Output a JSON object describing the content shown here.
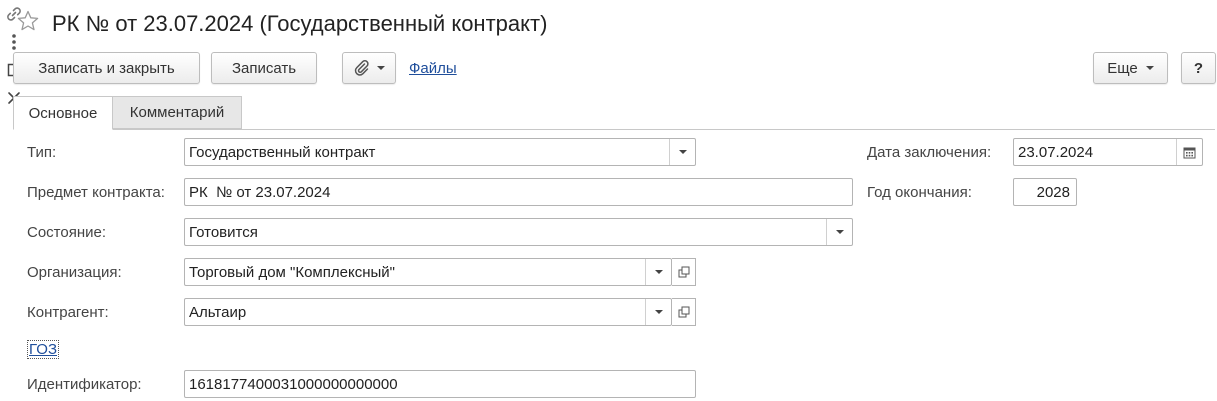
{
  "window": {
    "title": "РК  № от 23.07.2024 (Государственный контракт)"
  },
  "toolbar": {
    "save_close_label": "Записать и закрыть",
    "save_label": "Записать",
    "files_link": "Файлы",
    "more_label": "Еще",
    "help_label": "?"
  },
  "tabs": [
    {
      "label": "Основное",
      "active": true
    },
    {
      "label": "Комментарий",
      "active": false
    }
  ],
  "form": {
    "type": {
      "label": "Тип:",
      "value": "Государственный контракт"
    },
    "subject": {
      "label": "Предмет контракта:",
      "value": "РК  № от 23.07.2024"
    },
    "state": {
      "label": "Состояние:",
      "value": "Готовится"
    },
    "organization": {
      "label": "Организация:",
      "value": "Торговый дом \"Комплексный\""
    },
    "counterparty": {
      "label": "Контрагент:",
      "value": "Альтаир"
    },
    "goz_link": "ГОЗ",
    "identifier": {
      "label": "Идентификатор:",
      "value": "1618177400031000000000000"
    },
    "conclusion_date": {
      "label": "Дата заключения:",
      "value": "23.07.2024"
    },
    "end_year": {
      "label": "Год окончания:",
      "value": "2028"
    }
  },
  "colors": {
    "link": "#1f4e9b",
    "tab_inactive_bg": "#e7e7e7",
    "border": "#b4b4b4"
  },
  "icons": [
    "star-icon",
    "link-icon",
    "more-vertical-icon",
    "maximize-icon",
    "close-icon",
    "paperclip-icon",
    "calendar-icon",
    "dropdown-arrow-icon",
    "open-form-icon"
  ]
}
